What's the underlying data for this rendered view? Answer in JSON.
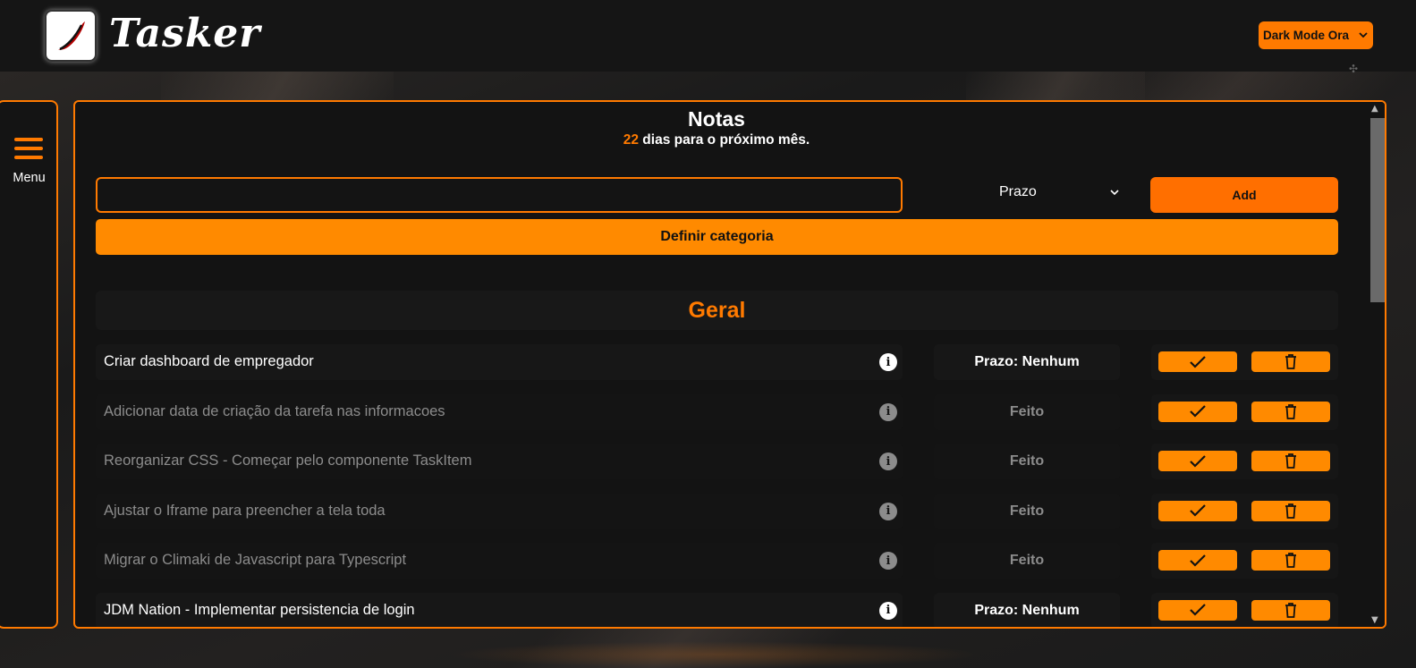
{
  "app": {
    "name": "Tasker",
    "theme_select": {
      "value": "Dark Mode Ora"
    }
  },
  "sidebar": {
    "menu_label": "Menu"
  },
  "main": {
    "title": "Notas",
    "countdown": {
      "days": "22",
      "text": " dias para o próximo mês."
    },
    "form": {
      "task_input": {
        "value": "",
        "placeholder": ""
      },
      "deadline_select": {
        "value": "Prazo"
      },
      "add_label": "Add",
      "category_label": "Definir categoria"
    },
    "category": {
      "name": "Geral",
      "tasks": [
        {
          "name": "Criar dashboard de empregador",
          "status": "Prazo: Nenhum",
          "done": false
        },
        {
          "name": "Adicionar data de criação da tarefa nas informacoes",
          "status": "Feito",
          "done": true
        },
        {
          "name": "Reorganizar CSS - Começar pelo componente TaskItem",
          "status": "Feito",
          "done": true
        },
        {
          "name": "Ajustar o Iframe para preencher a tela toda",
          "status": "Feito",
          "done": true
        },
        {
          "name": "Migrar o Climaki de Javascript para Typescript",
          "status": "Feito",
          "done": true
        },
        {
          "name": "JDM Nation - Implementar persistencia de login",
          "status": "Prazo: Nenhum",
          "done": false
        }
      ]
    }
  },
  "colors": {
    "accent": "#ff7a00",
    "button": "#ff8a00",
    "background": "#131313",
    "muted_text": "#8c8c8c"
  },
  "icons": {
    "logo": "tasker-logo-icon",
    "menu": "hamburger-menu-icon",
    "info": "info-icon",
    "complete": "checkmark-icon",
    "delete": "trash-icon",
    "dropdown": "chevron-down-icon"
  }
}
